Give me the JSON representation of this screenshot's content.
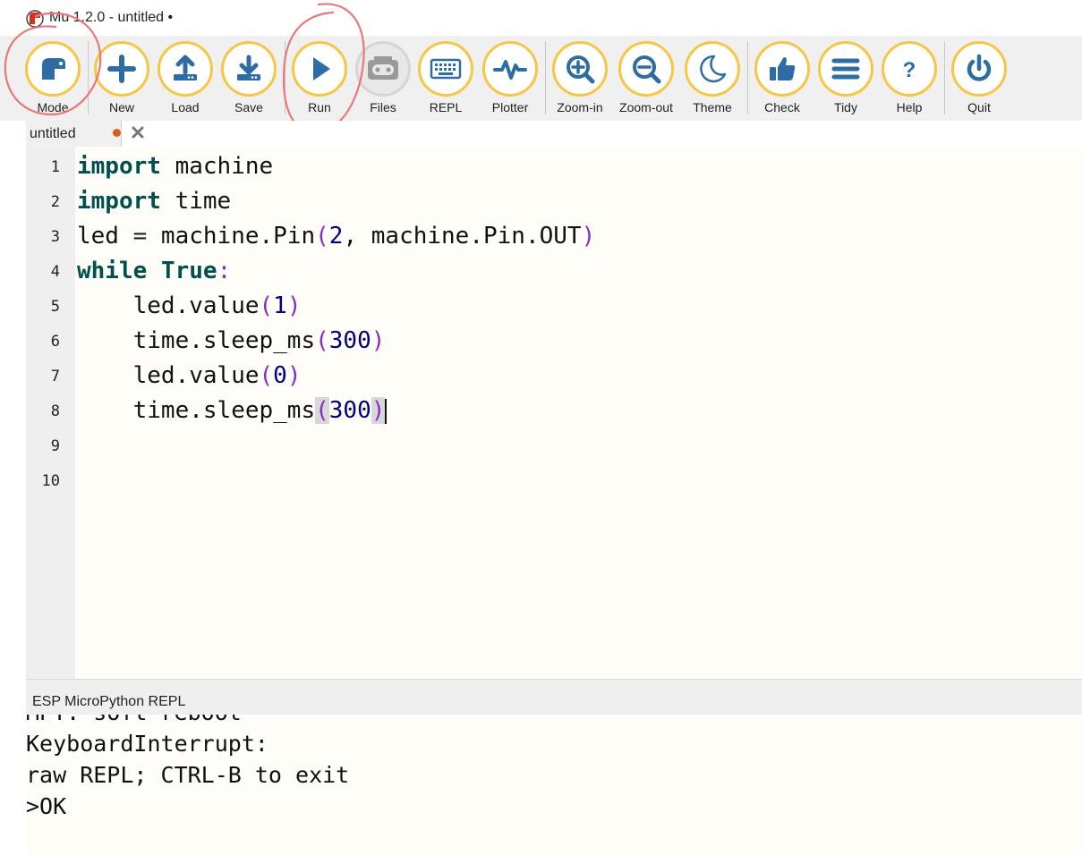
{
  "window": {
    "title": "Mu 1.2.0 - untitled •"
  },
  "toolbar": {
    "buttons": [
      {
        "label": "Mode",
        "icon": "mode-icon"
      },
      {
        "label": "New",
        "icon": "plus-icon"
      },
      {
        "label": "Load",
        "icon": "upload-icon"
      },
      {
        "label": "Save",
        "icon": "download-icon"
      },
      {
        "label": "Run",
        "icon": "play-icon"
      },
      {
        "label": "Files",
        "icon": "microbit-icon",
        "disabled": true
      },
      {
        "label": "REPL",
        "icon": "keyboard-icon"
      },
      {
        "label": "Plotter",
        "icon": "pulse-icon"
      },
      {
        "label": "Zoom-in",
        "icon": "zoom-in-icon"
      },
      {
        "label": "Zoom-out",
        "icon": "zoom-out-icon"
      },
      {
        "label": "Theme",
        "icon": "moon-icon"
      },
      {
        "label": "Check",
        "icon": "thumbs-up-icon"
      },
      {
        "label": "Tidy",
        "icon": "lines-icon"
      },
      {
        "label": "Help",
        "icon": "question-icon"
      },
      {
        "label": "Quit",
        "icon": "power-icon"
      }
    ]
  },
  "tabs": [
    {
      "label": "untitled",
      "modified": true
    }
  ],
  "editor": {
    "line_numbers": [
      "1",
      "2",
      "3",
      "4",
      "5",
      "6",
      "7",
      "8",
      "9",
      "10"
    ],
    "lines": [
      [
        {
          "t": "import",
          "c": "kw"
        },
        {
          "t": " machine"
        }
      ],
      [
        {
          "t": "import",
          "c": "kw"
        },
        {
          "t": " time"
        }
      ],
      [
        {
          "t": "led "
        },
        {
          "t": "=",
          "c": "op"
        },
        {
          "t": " machine"
        },
        {
          "t": "."
        },
        {
          "t": "Pin"
        },
        {
          "t": "(",
          "c": "paren"
        },
        {
          "t": "2",
          "c": "num"
        },
        {
          "t": ", machine"
        },
        {
          "t": "."
        },
        {
          "t": "Pin"
        },
        {
          "t": "."
        },
        {
          "t": "OUT"
        },
        {
          "t": ")",
          "c": "paren"
        }
      ],
      [
        {
          "t": "while",
          "c": "kw"
        },
        {
          "t": " "
        },
        {
          "t": "True",
          "c": "kw"
        },
        {
          "t": ":",
          "c": "paren"
        }
      ],
      [
        {
          "t": "    led"
        },
        {
          "t": "."
        },
        {
          "t": "value"
        },
        {
          "t": "(",
          "c": "paren"
        },
        {
          "t": "1",
          "c": "num"
        },
        {
          "t": ")",
          "c": "paren"
        }
      ],
      [
        {
          "t": "    time"
        },
        {
          "t": "."
        },
        {
          "t": "sleep_ms"
        },
        {
          "t": "(",
          "c": "paren"
        },
        {
          "t": "300",
          "c": "num"
        },
        {
          "t": ")",
          "c": "paren"
        }
      ],
      [
        {
          "t": "    led"
        },
        {
          "t": "."
        },
        {
          "t": "value"
        },
        {
          "t": "(",
          "c": "paren"
        },
        {
          "t": "0",
          "c": "num"
        },
        {
          "t": ")",
          "c": "paren"
        }
      ],
      [
        {
          "t": "    time"
        },
        {
          "t": "."
        },
        {
          "t": "sleep_ms"
        },
        {
          "t": "(",
          "c": "paren brace-hl"
        },
        {
          "t": "300",
          "c": "num"
        },
        {
          "t": ")",
          "c": "paren brace-hl"
        },
        {
          "t": "",
          "c": "cursor"
        }
      ],
      [],
      []
    ]
  },
  "repl": {
    "title": "ESP MicroPython REPL",
    "lines": [
      "MPY: soft reboot",
      "KeyboardInterrupt:",
      "raw REPL; CTRL-B to exit",
      ">OK"
    ]
  }
}
